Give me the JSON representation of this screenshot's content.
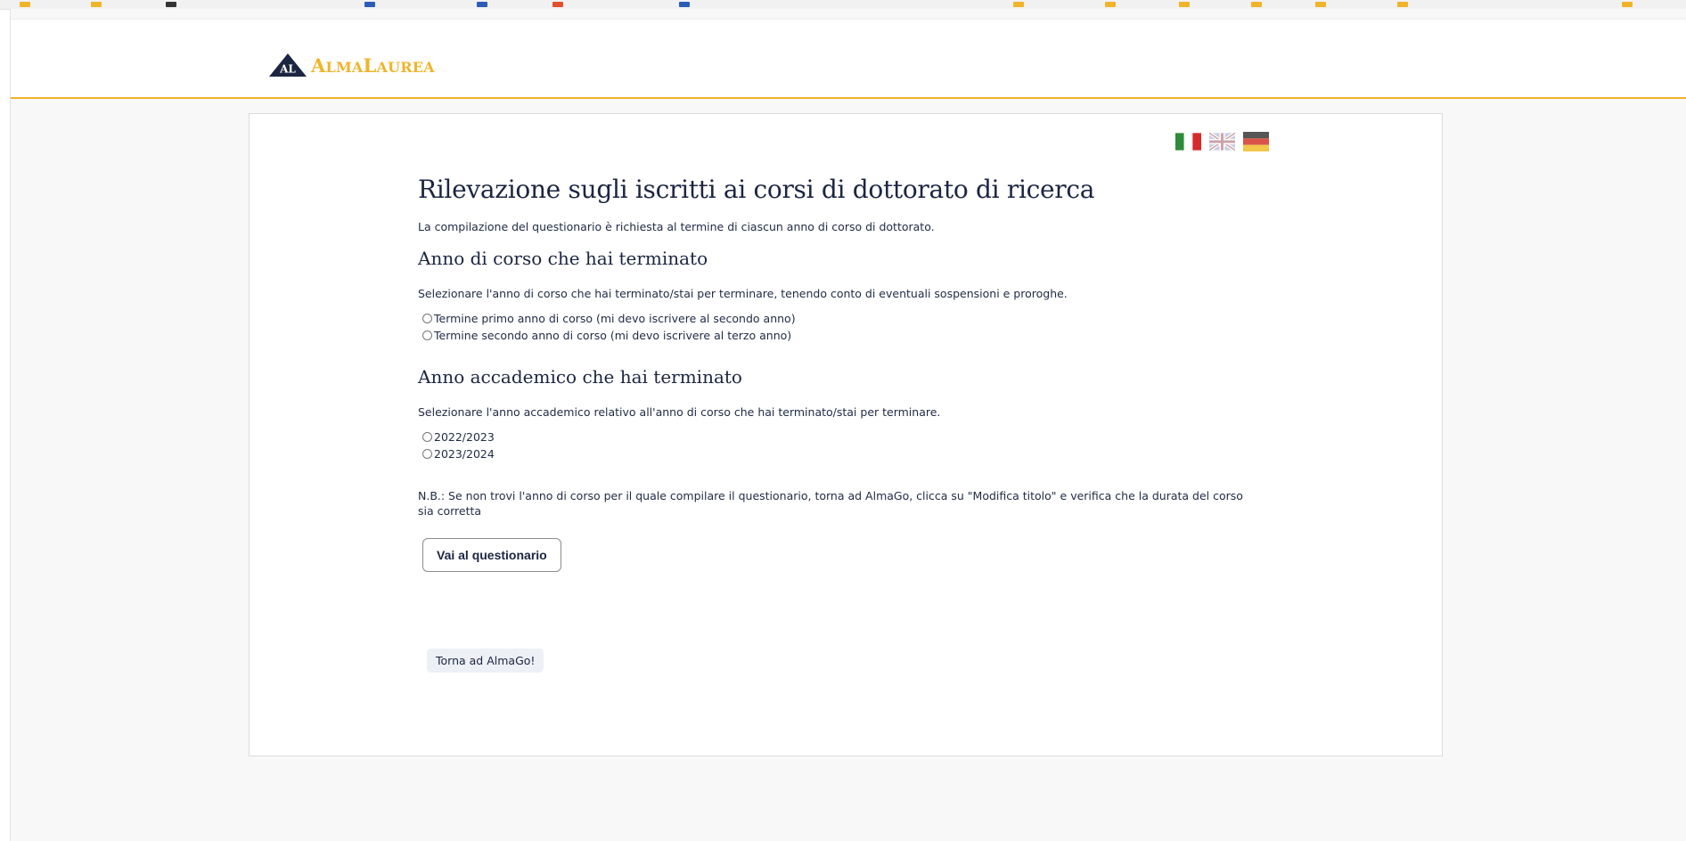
{
  "brand": {
    "logo_badge": "AL",
    "logo_text": "ALMALAUREA",
    "accent_color": "#f0b429",
    "primary_color": "#1c2541"
  },
  "languages": [
    {
      "code": "it",
      "icon": "italian-flag-icon"
    },
    {
      "code": "en",
      "icon": "uk-flag-icon"
    },
    {
      "code": "de",
      "icon": "german-flag-icon"
    }
  ],
  "page": {
    "title": "Rilevazione sugli iscritti ai corsi di dottorato di ricerca",
    "intro": "La compilazione del questionario è richiesta al termine di ciascun anno di corso di dottorato."
  },
  "course_year": {
    "heading": "Anno di corso che hai terminato",
    "hint": "Selezionare l'anno di corso che hai terminato/stai per terminare, tenendo conto di eventuali sospensioni e proroghe.",
    "options": [
      "Termine primo anno di corso (mi devo iscrivere al secondo anno)",
      "Termine secondo anno di corso (mi devo iscrivere al terzo anno)"
    ]
  },
  "academic_year": {
    "heading": "Anno accademico che hai terminato",
    "hint": "Selezionare l'anno accademico relativo all'anno di corso che hai terminato/stai per terminare.",
    "options": [
      "2022/2023",
      "2023/2024"
    ]
  },
  "note": "N.B.: Se non trovi l'anno di corso per il quale compilare il questionario, torna ad AlmaGo, clicca su \"Modifica titolo\" e verifica che la durata del corso sia corretta",
  "buttons": {
    "questionnaire": "Vai al questionario",
    "back": "Torna ad AlmaGo!"
  }
}
